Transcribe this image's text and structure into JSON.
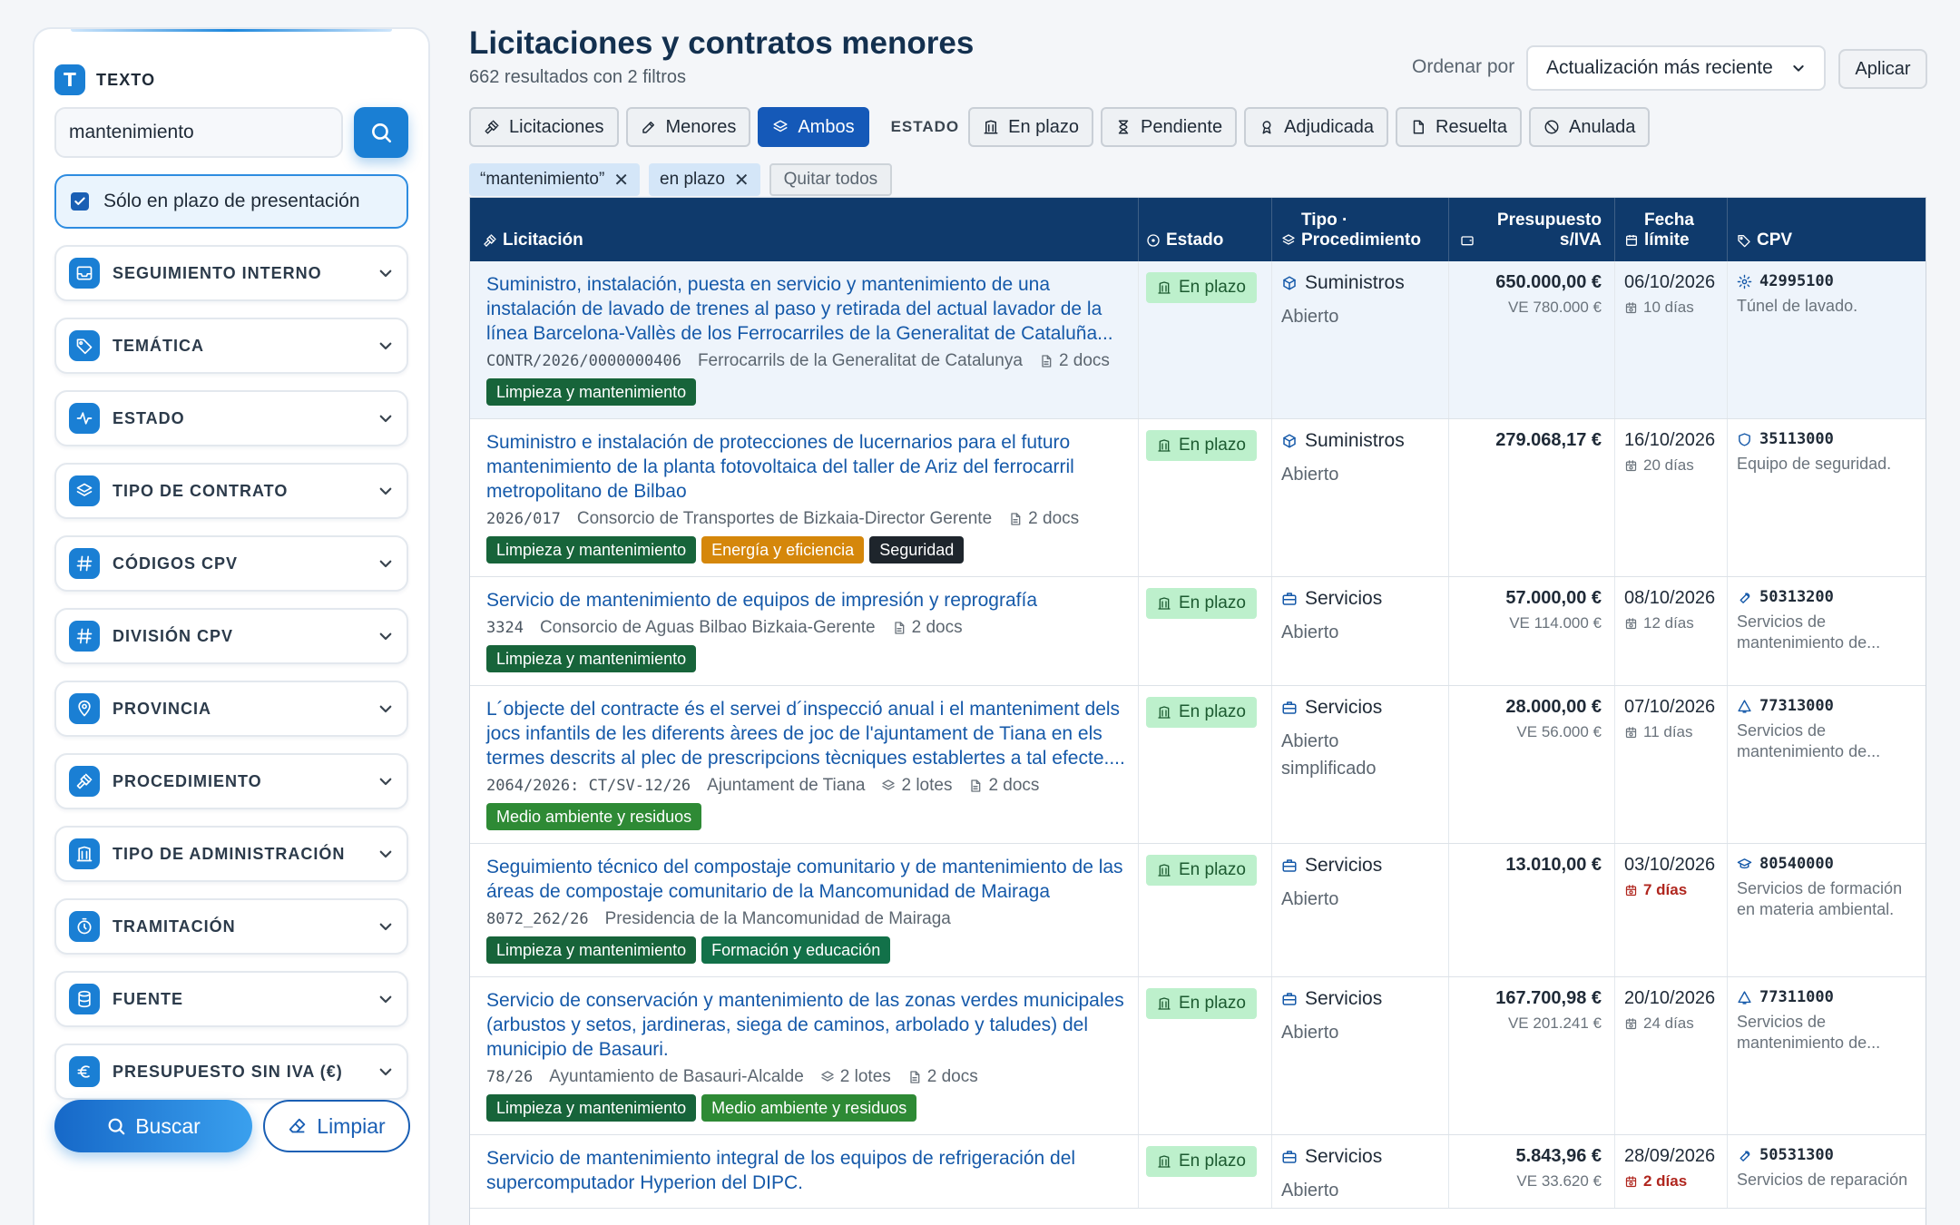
{
  "sidebar": {
    "texto_label": "TEXTO",
    "texto_icon": "T",
    "search_value": "mantenimiento",
    "checkbox_label": "Sólo en plazo de presentación",
    "groups": [
      {
        "label": "SEGUIMIENTO INTERNO",
        "icon": "inbox-icon"
      },
      {
        "label": "TEMÁTICA",
        "icon": "tag-icon"
      },
      {
        "label": "ESTADO",
        "icon": "pulse-icon"
      },
      {
        "label": "TIPO DE CONTRATO",
        "icon": "layers-icon"
      },
      {
        "label": "CÓDIGOS CPV",
        "icon": "hash-icon"
      },
      {
        "label": "DIVISIÓN CPV",
        "icon": "hash-icon"
      },
      {
        "label": "PROVINCIA",
        "icon": "map-pin-icon"
      },
      {
        "label": "PROCEDIMIENTO",
        "icon": "gavel-icon"
      },
      {
        "label": "TIPO DE ADMINISTRACIÓN",
        "icon": "building-icon"
      },
      {
        "label": "TRAMITACIÓN",
        "icon": "stopwatch-icon"
      },
      {
        "label": "FUENTE",
        "icon": "database-icon"
      },
      {
        "label": "PRESUPUESTO SIN IVA (€)",
        "icon": "euro-icon"
      }
    ],
    "buscar_label": "Buscar",
    "limpiar_label": "Limpiar"
  },
  "header": {
    "title": "Licitaciones y contratos menores",
    "results": "662 resultados con 2 filtros",
    "sort_label": "Ordenar por",
    "sort_value": "Actualización más reciente",
    "apply_label": "Aplicar"
  },
  "filters": {
    "types": [
      {
        "label": "Licitaciones",
        "icon": "gavel-icon",
        "active": false
      },
      {
        "label": "Menores",
        "icon": "edit-icon",
        "active": false
      },
      {
        "label": "Ambos",
        "icon": "layers-icon",
        "active": true
      }
    ],
    "estado_label": "ESTADO",
    "estados": [
      {
        "label": "En plazo",
        "icon": "building-icon"
      },
      {
        "label": "Pendiente",
        "icon": "hourglass-icon"
      },
      {
        "label": "Adjudicada",
        "icon": "award-icon"
      },
      {
        "label": "Resuelta",
        "icon": "document-icon"
      },
      {
        "label": "Anulada",
        "icon": "ban-icon"
      }
    ]
  },
  "active_tags": [
    "“mantenimiento”",
    "en plazo"
  ],
  "clear_all_label": "Quitar todos",
  "table": {
    "headers": {
      "licitacion": "Licitación",
      "estado": "Estado",
      "tipo": "Tipo · Procedimiento",
      "presupuesto": "Presupuesto s/IVA",
      "fecha": "Fecha límite",
      "cpv": "CPV"
    },
    "rows": [
      {
        "title": "Suministro, instalación, puesta en servicio y mantenimiento de una instalación de lavado de trenes al paso y retirada del actual lavador de la línea Barcelona-Vallès de los Ferrocarriles de la Generalitat de Cataluña...",
        "expediente": "CONTR/2026/0000000406",
        "organismo": "Ferrocarrils de la Generalitat de Catalunya",
        "lotes": "",
        "docs": "2 docs",
        "cats": [
          {
            "label": "Limpieza y mantenimiento",
            "color": "#17643a"
          }
        ],
        "estado": "En plazo",
        "tipo": "Suministros",
        "tipo_icon": "package-icon",
        "proc": "Abierto",
        "amount": "650.000,00 €",
        "ve": "VE 780.000 €",
        "fecha": "06/10/2026",
        "dias": "10 días",
        "urgent": false,
        "cpv_icon": "gear-icon",
        "cpv_code": "42995100",
        "cpv_desc": "Túnel de lavado."
      },
      {
        "title": "Suministro e instalación de protecciones de lucernarios para el futuro mantenimiento de la planta fotovoltaica del taller de Ariz del ferrocarril metropolitano de Bilbao",
        "expediente": "2026/017",
        "organismo": "Consorcio de Transportes de Bizkaia-Director Gerente",
        "lotes": "",
        "docs": "2 docs",
        "cats": [
          {
            "label": "Limpieza y mantenimiento",
            "color": "#17643a"
          },
          {
            "label": "Energía y eficiencia",
            "color": "#d5870b"
          },
          {
            "label": "Seguridad",
            "color": "#1e252c"
          }
        ],
        "estado": "En plazo",
        "tipo": "Suministros",
        "tipo_icon": "package-icon",
        "proc": "Abierto",
        "amount": "279.068,17 €",
        "ve": "",
        "fecha": "16/10/2026",
        "dias": "20 días",
        "urgent": false,
        "cpv_icon": "shield-icon",
        "cpv_code": "35113000",
        "cpv_desc": "Equipo de seguridad."
      },
      {
        "title": "Servicio de mantenimiento de equipos de impresión y reprografía",
        "expediente": "3324",
        "organismo": "Consorcio de Aguas Bilbao Bizkaia-Gerente",
        "lotes": "",
        "docs": "2 docs",
        "cats": [
          {
            "label": "Limpieza y mantenimiento",
            "color": "#17643a"
          }
        ],
        "estado": "En plazo",
        "tipo": "Servicios",
        "tipo_icon": "briefcase-icon",
        "proc": "Abierto",
        "amount": "57.000,00 €",
        "ve": "VE 114.000 €",
        "fecha": "08/10/2026",
        "dias": "12 días",
        "urgent": false,
        "cpv_icon": "wrench-icon",
        "cpv_code": "50313200",
        "cpv_desc": "Servicios de mantenimiento de..."
      },
      {
        "title": "L´objecte del contracte és el servei d´inspecció anual i el manteniment dels jocs infantils de les diferents àrees de joc de l'ajuntament de Tiana en els termes descrits al plec de prescripcions tècniques establertes a tal efecte....",
        "expediente": "2064/2026: CT/SV-12/26",
        "organismo": "Ajuntament de Tiana",
        "lotes": "2 lotes",
        "docs": "2 docs",
        "cats": [
          {
            "label": "Medio ambiente y residuos",
            "color": "#2e8a35"
          }
        ],
        "estado": "En plazo",
        "tipo": "Servicios",
        "tipo_icon": "briefcase-icon",
        "proc": "Abierto simplificado",
        "amount": "28.000,00 €",
        "ve": "VE 56.000 €",
        "fecha": "07/10/2026",
        "dias": "11 días",
        "urgent": false,
        "cpv_icon": "bell-icon",
        "cpv_code": "77313000",
        "cpv_desc": "Servicios de mantenimiento de..."
      },
      {
        "title": "Seguimiento técnico del compostaje comunitario y de mantenimiento de las áreas de compostaje comunitario de la Mancomunidad de Mairaga",
        "expediente": "8072_262/26",
        "organismo": "Presidencia de la Mancomunidad de Mairaga",
        "lotes": "",
        "docs": "",
        "cats": [
          {
            "label": "Limpieza y mantenimiento",
            "color": "#17643a"
          },
          {
            "label": "Formación y educación",
            "color": "#127149"
          }
        ],
        "estado": "En plazo",
        "tipo": "Servicios",
        "tipo_icon": "briefcase-icon",
        "proc": "Abierto",
        "amount": "13.010,00 €",
        "ve": "",
        "fecha": "03/10/2026",
        "dias": "7 días",
        "urgent": true,
        "cpv_icon": "graduation-cap-icon",
        "cpv_code": "80540000",
        "cpv_desc": "Servicios de formación en materia ambiental."
      },
      {
        "title": "Servicio de conservación y mantenimiento de las zonas verdes municipales (arbustos y setos, jardineras, siega de caminos, arbolado y taludes) del municipio de Basauri.",
        "expediente": "78/26",
        "organismo": "Ayuntamiento de Basauri-Alcalde",
        "lotes": "2 lotes",
        "docs": "2 docs",
        "cats": [
          {
            "label": "Limpieza y mantenimiento",
            "color": "#17643a"
          },
          {
            "label": "Medio ambiente y residuos",
            "color": "#2e8a35"
          }
        ],
        "estado": "En plazo",
        "tipo": "Servicios",
        "tipo_icon": "briefcase-icon",
        "proc": "Abierto",
        "amount": "167.700,98 €",
        "ve": "VE 201.241 €",
        "fecha": "20/10/2026",
        "dias": "24 días",
        "urgent": false,
        "cpv_icon": "bell-icon",
        "cpv_code": "77311000",
        "cpv_desc": "Servicios de mantenimiento de..."
      },
      {
        "title": "Servicio de mantenimiento integral de los equipos de refrigeración del supercomputador Hyperion del DIPC.",
        "expediente": "",
        "organismo": "",
        "lotes": "",
        "docs": "",
        "cats": [],
        "estado": "En plazo",
        "tipo": "Servicios",
        "tipo_icon": "briefcase-icon",
        "proc": "Abierto",
        "amount": "5.843,96 €",
        "ve": "VE 33.620 €",
        "fecha": "28/09/2026",
        "dias": "2 días",
        "urgent": true,
        "cpv_icon": "wrench-icon",
        "cpv_code": "50531300",
        "cpv_desc": "Servicios de reparación"
      }
    ]
  },
  "colors": {
    "accent": "#1a7fd4",
    "header_bg": "#0f3a6c",
    "active_chip": "#1559b8",
    "link": "#1559a9",
    "badge_bg": "#bdf0cc",
    "urgent": "#b0261e"
  }
}
